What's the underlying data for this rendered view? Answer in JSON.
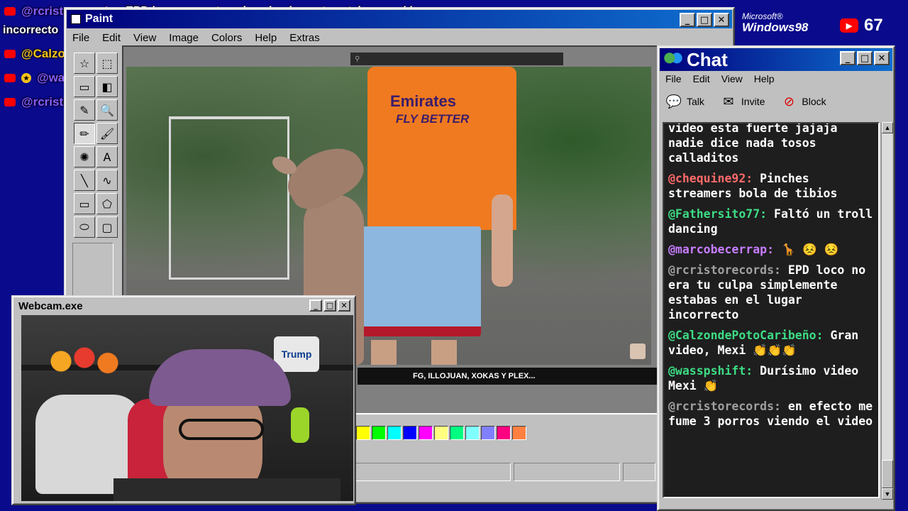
{
  "overlay_messages": [
    {
      "user": "@rcristorecords",
      "sep": ":",
      "text": "EPD loco no era tu culpa simplemente estabas en el lugar",
      "color": "#8a5cff",
      "badge": "yt"
    },
    {
      "user": "",
      "sep": "",
      "text": "incorrecto",
      "color": "#ffffff",
      "badge": ""
    },
    {
      "user": "@CalzondePotoCaribeño",
      "sep": ":",
      "text": "Gran video, Mexi 👏👏👏",
      "color": "#f5c518",
      "badge": "yt"
    },
    {
      "user": "@wasspshift",
      "sep": ":",
      "text": "Durísimo video Mexi 👏",
      "color": "#8a5cff",
      "badge": "yt-star"
    },
    {
      "user": "@rcristorecords",
      "sep": ":",
      "text": "en efecto me fume 3 porros viendo el video",
      "color": "#8a5cff",
      "badge": "yt"
    }
  ],
  "paint": {
    "title": "Paint",
    "menu": [
      "File",
      "Edit",
      "View",
      "Image",
      "Colors",
      "Help",
      "Extras"
    ],
    "tools": [
      "select-star",
      "select-rect",
      "eraser",
      "fill",
      "picker",
      "magnifier",
      "pencil",
      "brush",
      "airbrush",
      "text",
      "line",
      "curve",
      "rectangle",
      "polygon",
      "ellipse",
      "rounded-rect"
    ],
    "tool_glyphs": [
      "☆",
      "⬚",
      "▭",
      "◧",
      "✎",
      "🔍",
      "✏",
      "🖌",
      "✺",
      "A",
      "╲",
      "∿",
      "▭",
      "⬠",
      "⬭",
      "▢"
    ],
    "palette": [
      "#ffff00",
      "#00ff00",
      "#00ffff",
      "#0000ff",
      "#ff00ff",
      "#ffff80",
      "#00ff80",
      "#80ffff",
      "#8080ff",
      "#ff0080",
      "#ff8040"
    ],
    "video_ticker": "FG, ILLOJUAN, XOKAS Y PLEX...",
    "shirt_brand": "Emirates",
    "shirt_slogan": "FLY BETTER"
  },
  "branding": {
    "microsoft": "Microsoft®",
    "windows": "Windows98",
    "viewer_count": "67"
  },
  "chat": {
    "title": "Chat",
    "menu": [
      "File",
      "Edit",
      "View",
      "Help"
    ],
    "toolbar": [
      {
        "label": "Talk",
        "icon": "talk-icon",
        "glyph": "💬"
      },
      {
        "label": "Invite",
        "icon": "invite-icon",
        "glyph": "✉"
      },
      {
        "label": "Block",
        "icon": "block-icon",
        "glyph": "⊘"
      }
    ],
    "messages": [
      {
        "user": "",
        "text": "video esta fuerte jajaja nadie dice nada tosos calladitos",
        "color": "#ffffff"
      },
      {
        "user": "@chequine92:",
        "text": "Pinches streamers bola de tibios",
        "color": "#ff6a6a"
      },
      {
        "user": "@Fathersito77:",
        "text": "Faltó un troll dancing",
        "color": "#3ddc84"
      },
      {
        "user": "@marcobecerrap:",
        "text": "🦒 😣 😣",
        "color": "#c77dff"
      },
      {
        "user": "@rcristorecords:",
        "text": "EPD loco no era tu culpa simplemente estabas en el lugar incorrecto",
        "color": "#a0a0a0"
      },
      {
        "user": "@CalzondePotoCaribeño:",
        "text": "Gran video, Mexi 👏👏👏",
        "color": "#3ddc84"
      },
      {
        "user": "@wasspshift:",
        "text": "Durísimo video Mexi 👏",
        "color": "#3ddc84"
      },
      {
        "user": "@rcristorecords:",
        "text": "en efecto me fume 3 porros viendo el video",
        "color": "#a0a0a0"
      }
    ]
  },
  "webcam": {
    "title": "Webcam.exe",
    "poster_text": "Trump"
  },
  "window_buttons": {
    "minimize": "_",
    "maximize": "□",
    "close": "✕"
  }
}
